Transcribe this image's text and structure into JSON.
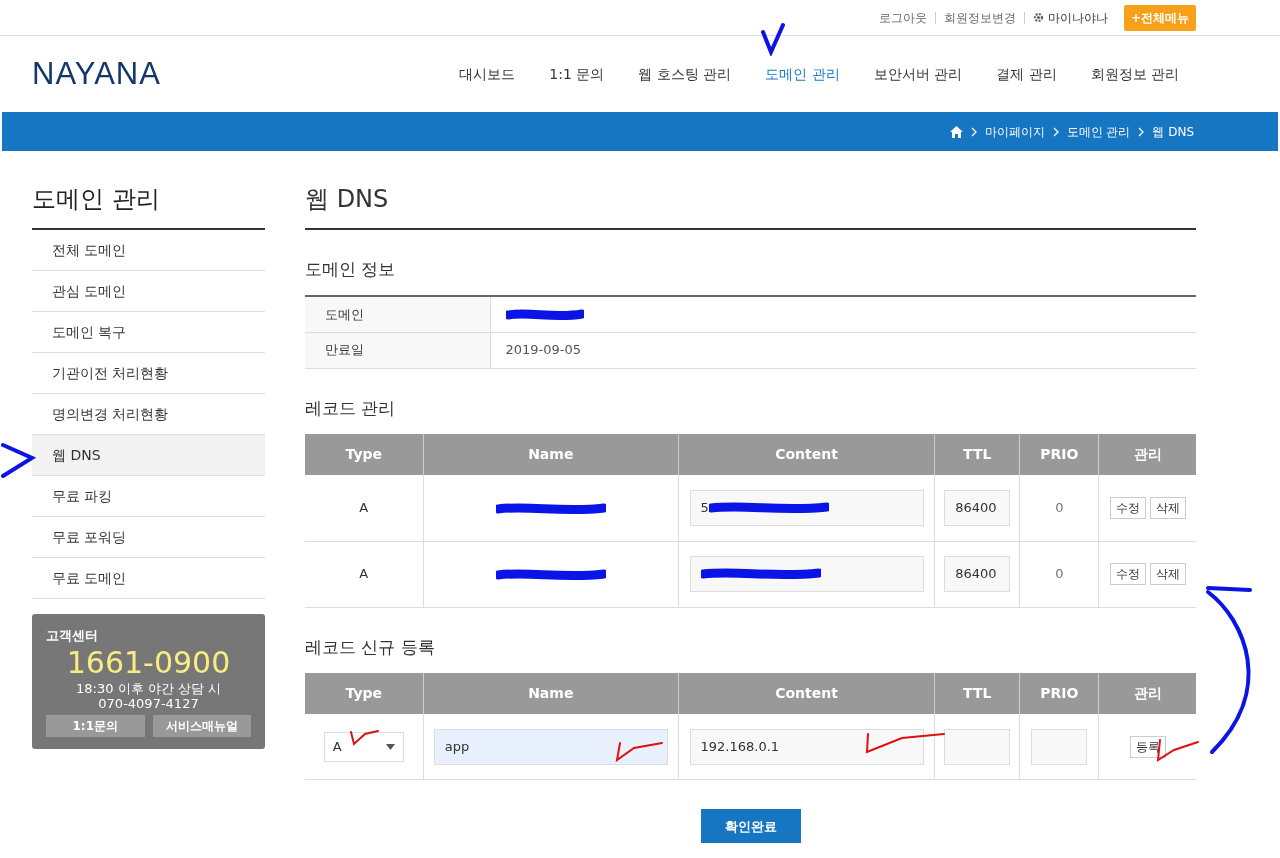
{
  "top_links": [
    {
      "label": "로그아웃",
      "kind": "link"
    },
    {
      "label": "회원정보변경",
      "kind": "link"
    },
    {
      "label": "마이나야나",
      "kind": "gear"
    }
  ],
  "all_menu_button": "+전체메뉴",
  "logo": "NAYANA",
  "nav": [
    {
      "label": "대시보드",
      "selected": false
    },
    {
      "label": "1:1 문의",
      "selected": false
    },
    {
      "label": "웹 호스팅 관리",
      "selected": false
    },
    {
      "label": "도메인 관리",
      "selected": true
    },
    {
      "label": "보안서버 관리",
      "selected": false
    },
    {
      "label": "결제 관리",
      "selected": false
    },
    {
      "label": "회원정보 관리",
      "selected": false
    }
  ],
  "breadcrumb": [
    "마이페이지",
    "도메인 관리",
    "웹 DNS"
  ],
  "sidebar": {
    "title": "도메인 관리",
    "items": [
      {
        "label": "전체 도메인",
        "selected": false
      },
      {
        "label": "관심 도메인",
        "selected": false
      },
      {
        "label": "도메인 복구",
        "selected": false
      },
      {
        "label": "기관이전 처리현황",
        "selected": false
      },
      {
        "label": "명의변경 처리현황",
        "selected": false
      },
      {
        "label": "웹 DNS",
        "selected": true
      },
      {
        "label": "무료 파킹",
        "selected": false
      },
      {
        "label": "무료 포워딩",
        "selected": false
      },
      {
        "label": "무료 도메인",
        "selected": false
      }
    ]
  },
  "support": {
    "title": "고객센터",
    "phone": "1661-0900",
    "note": "18:30 이후 야간 상담 시",
    "night_phone": "070-4097-4127",
    "buttons": [
      "1:1문의",
      "서비스매뉴얼"
    ]
  },
  "page_title": "웹 DNS",
  "domain_info": {
    "title": "도메인 정보",
    "rows": [
      {
        "label": "도메인",
        "redacted": true
      },
      {
        "label": "만료일",
        "value": "2019-09-05"
      }
    ]
  },
  "records": {
    "title": "레코드 관리",
    "columns": [
      "Type",
      "Name",
      "Content",
      "TTL",
      "PRIO",
      "관리"
    ],
    "rows": [
      {
        "type": "A",
        "name": {
          "redacted": true
        },
        "content": {
          "redacted": true,
          "value": "5"
        },
        "ttl": "86400",
        "prio": "0",
        "actions": [
          "수정",
          "삭제"
        ]
      },
      {
        "type": "A",
        "name": {
          "redacted": true
        },
        "content": {
          "redacted": true
        },
        "ttl": "86400",
        "prio": "0",
        "actions": [
          "수정",
          "삭제"
        ]
      }
    ]
  },
  "new_record": {
    "title": "레코드 신규 등록",
    "columns": [
      "Type",
      "Name",
      "Content",
      "TTL",
      "PRIO",
      "관리"
    ],
    "type": "A",
    "name": "app",
    "content": "192.168.0.1",
    "button": "등록"
  },
  "confirm_button": "확인완료"
}
